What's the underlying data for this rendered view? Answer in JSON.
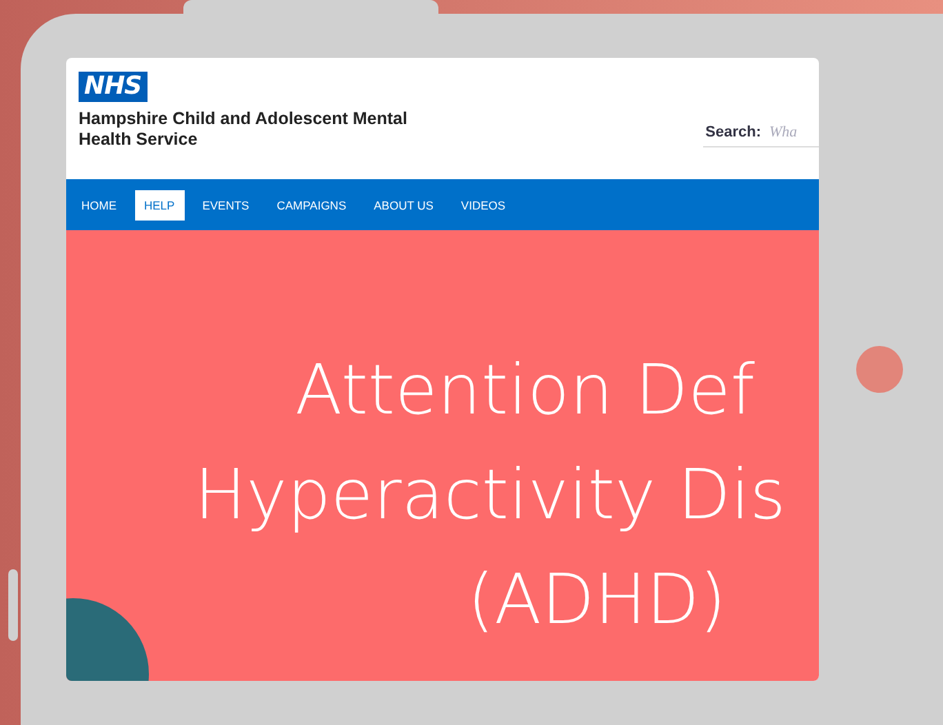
{
  "header": {
    "logo": "NHS",
    "title": "Hampshire Child and Adolescent Mental Health Service",
    "search": {
      "label": "Search:",
      "placeholder": "Wha"
    }
  },
  "nav": [
    {
      "label": "HOME",
      "selected": false
    },
    {
      "label": "HELP",
      "selected": true
    },
    {
      "label": "EVENTS",
      "selected": false
    },
    {
      "label": "CAMPAIGNS",
      "selected": false
    },
    {
      "label": "ABOUT US",
      "selected": false
    },
    {
      "label": "VIDEOS",
      "selected": false
    }
  ],
  "hero": {
    "title_lines": [
      "Attention Def",
      "Hyperactivity Dis",
      "(ADHD)"
    ]
  }
}
